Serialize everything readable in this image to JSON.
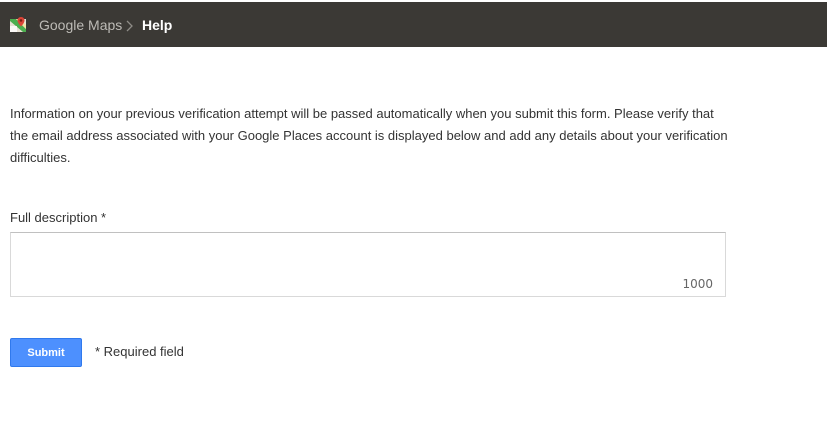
{
  "header": {
    "product_name": "Google Maps",
    "current_page": "Help",
    "logo_icon": "google-maps-logo-icon",
    "separator_icon": "chevron-right-icon",
    "background_color": "#3b3935"
  },
  "main": {
    "intro_text": "Information on your previous verification attempt will be passed automatically when you submit this form. Please verify that the email address associated with your Google Places account is displayed below and add any details about your verification difficulties.",
    "description_field": {
      "label": "Full description *",
      "value": "",
      "char_limit": "1000"
    },
    "submit_label": "Submit",
    "required_note": "* Required field",
    "accent_color": "#4d90fe"
  }
}
